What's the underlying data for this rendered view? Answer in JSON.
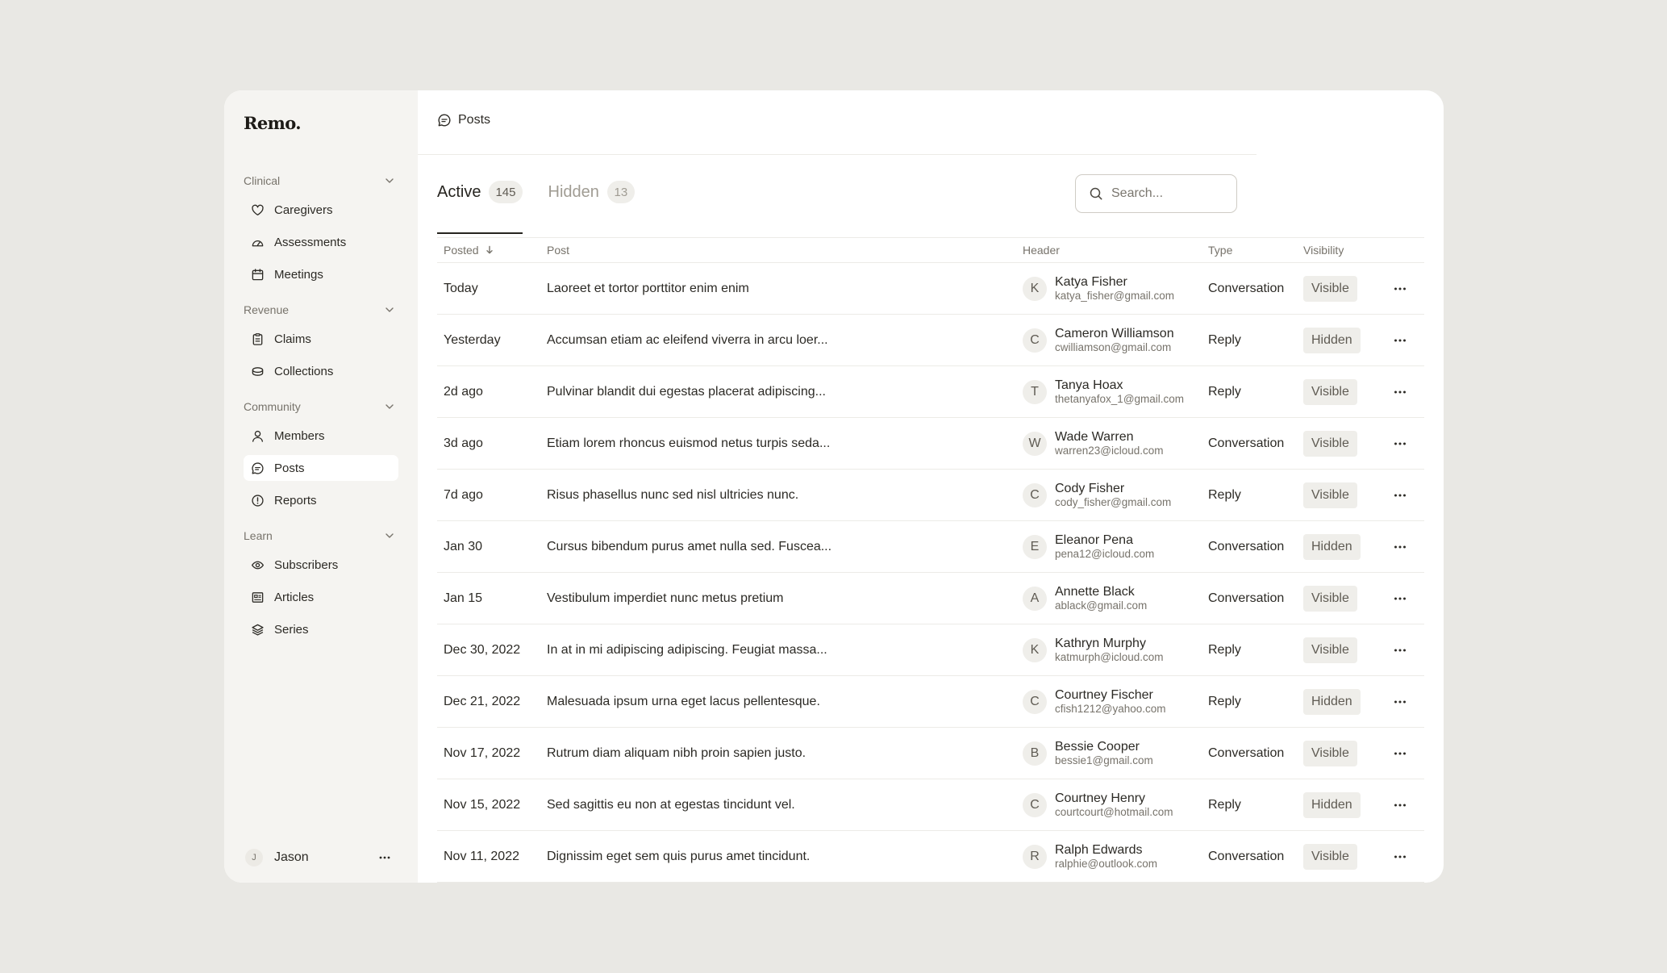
{
  "app": {
    "logo": "Remo."
  },
  "sidebar": {
    "groups": [
      {
        "label": "Clinical",
        "items": [
          {
            "label": "Caregivers",
            "icon": "heart-icon"
          },
          {
            "label": "Assessments",
            "icon": "gauge-icon"
          },
          {
            "label": "Meetings",
            "icon": "calendar-icon"
          }
        ]
      },
      {
        "label": "Revenue",
        "items": [
          {
            "label": "Claims",
            "icon": "clipboard-icon"
          },
          {
            "label": "Collections",
            "icon": "coins-icon"
          }
        ]
      },
      {
        "label": "Community",
        "items": [
          {
            "label": "Members",
            "icon": "user-icon"
          },
          {
            "label": "Posts",
            "icon": "message-icon",
            "active": true
          },
          {
            "label": "Reports",
            "icon": "alert-circle-icon"
          }
        ]
      },
      {
        "label": "Learn",
        "items": [
          {
            "label": "Subscribers",
            "icon": "eye-sync-icon"
          },
          {
            "label": "Articles",
            "icon": "newspaper-icon"
          },
          {
            "label": "Series",
            "icon": "layers-icon"
          }
        ]
      }
    ],
    "user": {
      "initial": "J",
      "name": "Jason"
    }
  },
  "header": {
    "breadcrumb": "Posts"
  },
  "tabs": [
    {
      "label": "Active",
      "count": "145",
      "active": true
    },
    {
      "label": "Hidden",
      "count": "13",
      "active": false
    }
  ],
  "search": {
    "placeholder": "Search..."
  },
  "table": {
    "columns": {
      "posted": "Posted",
      "post": "Post",
      "header": "Header",
      "type": "Type",
      "visibility": "Visibility"
    },
    "rows": [
      {
        "date": "Today",
        "post": "Laoreet et tortor porttitor enim enim",
        "initial": "K",
        "name": "Katya Fisher",
        "email": "katya_fisher@gmail.com",
        "type": "Conversation",
        "visibility": "Visible"
      },
      {
        "date": "Yesterday",
        "post": "Accumsan etiam ac eleifend viverra in arcu loer...",
        "initial": "C",
        "name": "Cameron Williamson",
        "email": "cwilliamson@gmail.com",
        "type": "Reply",
        "visibility": "Hidden"
      },
      {
        "date": "2d ago",
        "post": "Pulvinar blandit dui egestas placerat adipiscing...",
        "initial": "T",
        "name": "Tanya Hoax",
        "email": "thetanyafox_1@gmail.com",
        "type": "Reply",
        "visibility": "Visible"
      },
      {
        "date": "3d ago",
        "post": "Etiam lorem rhoncus euismod netus turpis seda...",
        "initial": "W",
        "name": "Wade Warren",
        "email": "warren23@icloud.com",
        "type": "Conversation",
        "visibility": "Visible"
      },
      {
        "date": "7d ago",
        "post": "Risus phasellus nunc sed nisl ultricies nunc.",
        "initial": "C",
        "name": "Cody Fisher",
        "email": "cody_fisher@gmail.com",
        "type": "Reply",
        "visibility": "Visible"
      },
      {
        "date": "Jan 30",
        "post": "Cursus bibendum purus amet nulla sed. Fuscea...",
        "initial": "E",
        "name": "Eleanor Pena",
        "email": "pena12@icloud.com",
        "type": "Conversation",
        "visibility": "Hidden"
      },
      {
        "date": "Jan 15",
        "post": "Vestibulum imperdiet nunc metus pretium",
        "initial": "A",
        "name": "Annette Black",
        "email": "ablack@gmail.com",
        "type": "Conversation",
        "visibility": "Visible"
      },
      {
        "date": "Dec 30, 2022",
        "post": "In at in mi adipiscing adipiscing. Feugiat massa...",
        "initial": "K",
        "name": "Kathryn Murphy",
        "email": "katmurph@icloud.com",
        "type": "Reply",
        "visibility": "Visible"
      },
      {
        "date": "Dec 21, 2022",
        "post": "Malesuada ipsum urna eget lacus pellentesque.",
        "initial": "C",
        "name": "Courtney Fischer",
        "email": "cfish1212@yahoo.com",
        "type": "Reply",
        "visibility": "Hidden"
      },
      {
        "date": "Nov 17, 2022",
        "post": "Rutrum diam aliquam nibh proin sapien justo.",
        "initial": "B",
        "name": "Bessie Cooper",
        "email": "bessie1@gmail.com",
        "type": "Conversation",
        "visibility": "Visible"
      },
      {
        "date": "Nov 15, 2022",
        "post": "Sed sagittis eu non at egestas tincidunt vel.",
        "initial": "C",
        "name": "Courtney Henry",
        "email": "courtcourt@hotmail.com",
        "type": "Reply",
        "visibility": "Hidden"
      },
      {
        "date": "Nov 11, 2022",
        "post": "Dignissim eget sem quis purus amet tincidunt.",
        "initial": "R",
        "name": "Ralph Edwards",
        "email": "ralphie@outlook.com",
        "type": "Conversation",
        "visibility": "Visible"
      }
    ]
  }
}
